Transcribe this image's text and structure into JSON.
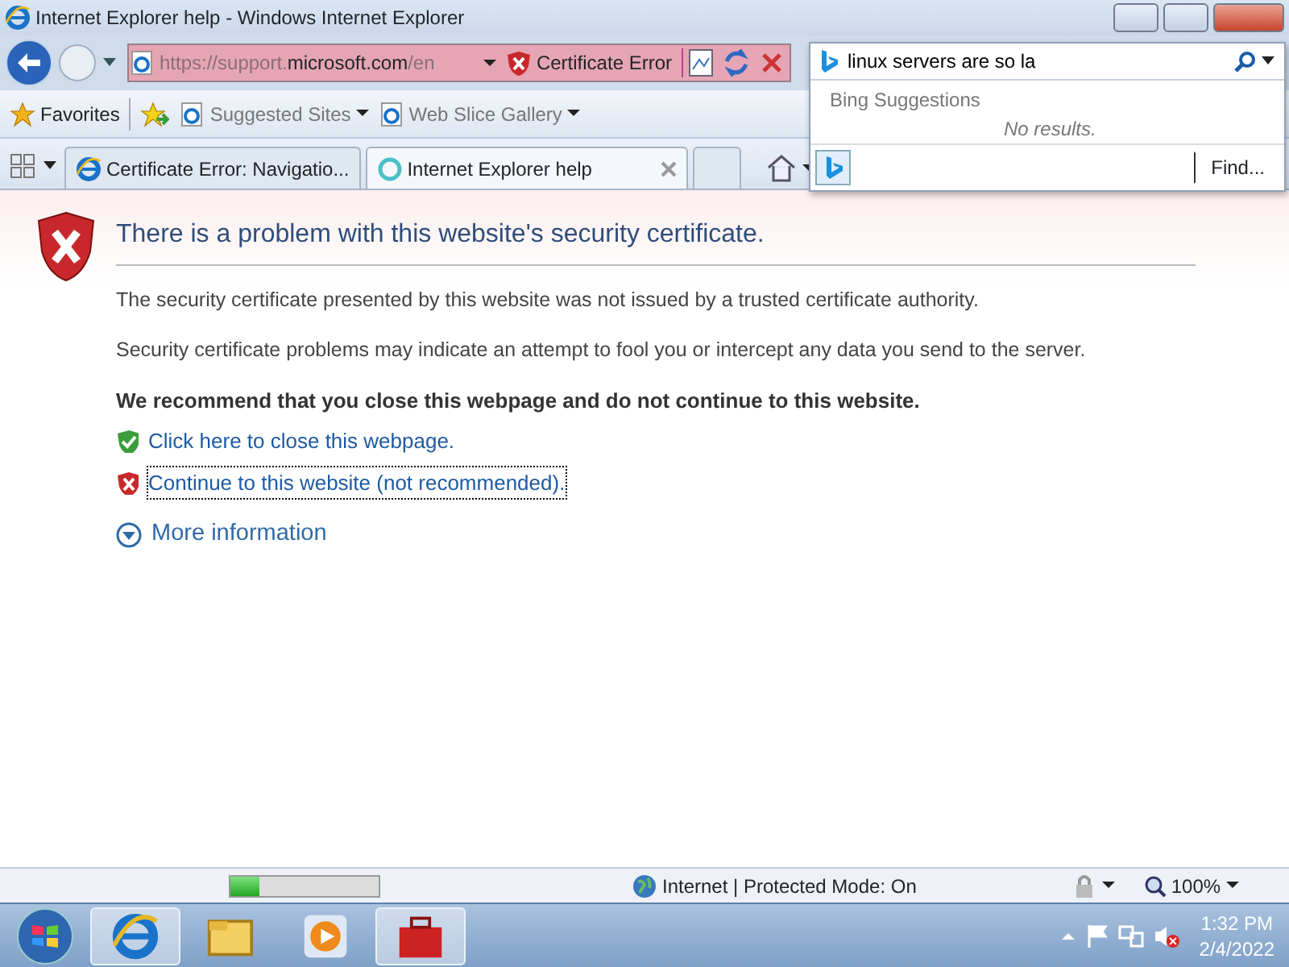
{
  "window": {
    "title": "Internet Explorer help - Windows Internet Explorer"
  },
  "address": {
    "url_prefix": "https://support.",
    "url_domain": "microsoft.com",
    "url_suffix": "/en",
    "security": "Certificate Error"
  },
  "search": {
    "value": "linux servers are so la",
    "suggestions_heading": "Bing Suggestions",
    "no_results": "No results.",
    "find_button": "Find..."
  },
  "favorites": {
    "label": "Favorites",
    "items": [
      {
        "label": "Suggested Sites"
      },
      {
        "label": "Web Slice Gallery"
      }
    ]
  },
  "tabs": [
    {
      "label": "Certificate Error: Navigatio...",
      "selected": false,
      "loading": false
    },
    {
      "label": "Internet Explorer help",
      "selected": true,
      "loading": true
    }
  ],
  "content": {
    "heading": "There is a problem with this website's security certificate.",
    "paragraphs": [
      "The security certificate presented by this website was not issued by a trusted certificate authority.",
      "Security certificate problems may indicate an attempt to fool you or intercept any data you send to the server."
    ],
    "recommendation": "We recommend that you close this webpage and do not continue to this website.",
    "links": [
      {
        "kind": "safe",
        "text": "Click here to close this webpage.",
        "focused": false
      },
      {
        "kind": "unsafe",
        "text": "Continue to this website (not recommended).",
        "focused": true
      }
    ],
    "more_info": "More information"
  },
  "status_bar": {
    "level": 0.2,
    "zone": "Internet | Protected Mode: On",
    "zoom": "100%"
  },
  "taskbar": {
    "apps": [
      {
        "kind": "browser",
        "active": true
      },
      {
        "kind": "folder",
        "active": false
      },
      {
        "kind": "media",
        "active": false
      },
      {
        "kind": "toolbox",
        "active": true
      }
    ],
    "time": "1:32 PM",
    "date": "2/4/2022"
  }
}
